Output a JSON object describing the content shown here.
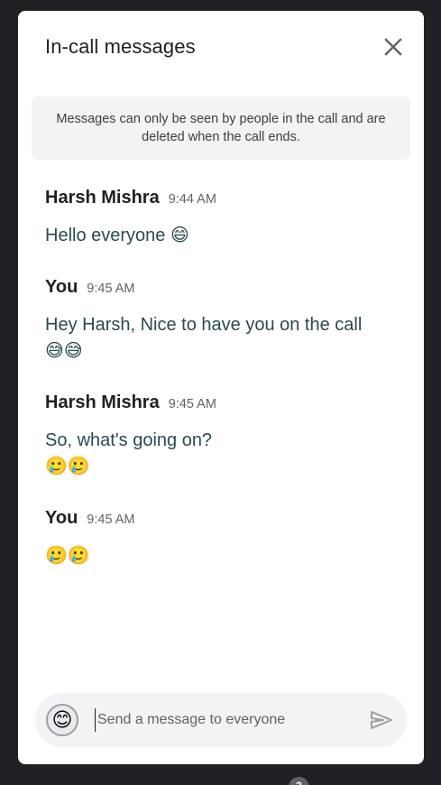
{
  "header": {
    "title": "In-call messages",
    "close_icon": "close-icon"
  },
  "notice": {
    "text": "Messages can only be seen by people in the call and are deleted when the call ends."
  },
  "messages": [
    {
      "sender": "Harsh Mishra",
      "time": "9:44 AM",
      "text": "Hello everyone 😄"
    },
    {
      "sender": "You",
      "time": "9:45 AM",
      "text": "Hey Harsh, Nice to have you on the call\n😅😅"
    },
    {
      "sender": "Harsh Mishra",
      "time": "9:45 AM",
      "text": "So, what's going on?\n🥲🥲"
    },
    {
      "sender": "You",
      "time": "9:45 AM",
      "text": "🥲🥲"
    }
  ],
  "composer": {
    "emoji_button": "😊",
    "placeholder": "Send a message to everyone",
    "value": "",
    "send_icon": "send-icon"
  },
  "bottom_badge": {
    "count": "2"
  },
  "colors": {
    "background": "#202124",
    "panel": "#ffffff",
    "message_text": "#2a4a52",
    "muted": "#5f6368"
  }
}
